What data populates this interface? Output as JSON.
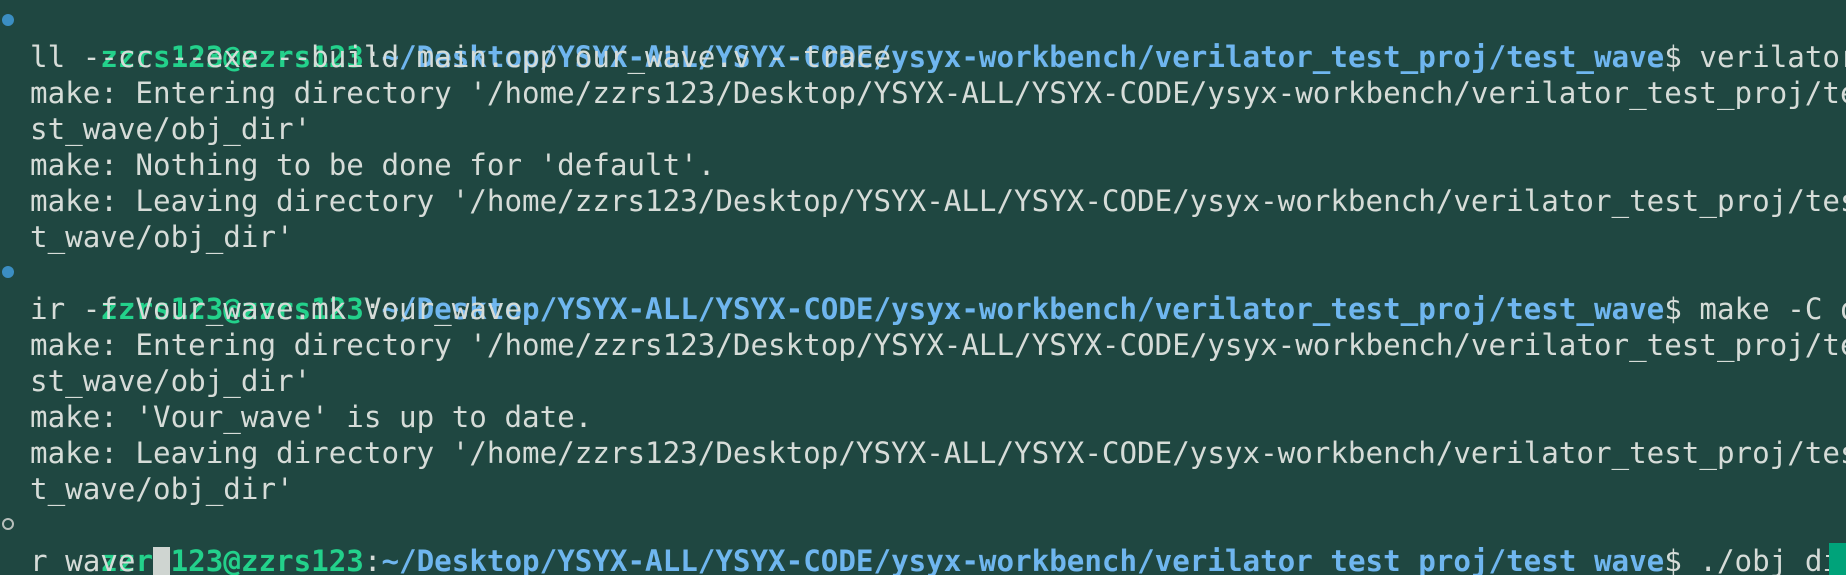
{
  "prompt": {
    "user_host": "zzrs123@zzrs123",
    "path": "~/Desktop/YSYX-ALL/YSYX-CODE/ysyx-workbench/verilator_test_proj/test_wave",
    "symbol": "$"
  },
  "blocks": [
    {
      "status": "done",
      "command_first": " verilator -Wa",
      "command_rest": [
        "ll --cc --exe --build main.cpp our_wave.v --trace"
      ],
      "output": [
        "make: Entering directory '/home/zzrs123/Desktop/YSYX-ALL/YSYX-CODE/ysyx-workbench/verilator_test_proj/te",
        "st_wave/obj_dir'",
        "make: Nothing to be done for 'default'.",
        "make: Leaving directory '/home/zzrs123/Desktop/YSYX-ALL/YSYX-CODE/ysyx-workbench/verilator_test_proj/tes",
        "t_wave/obj_dir'"
      ]
    },
    {
      "status": "done",
      "command_first": " make -C obj_d",
      "command_rest": [
        "ir -f Vour_wave.mk Vour_wave"
      ],
      "output": [
        "make: Entering directory '/home/zzrs123/Desktop/YSYX-ALL/YSYX-CODE/ysyx-workbench/verilator_test_proj/te",
        "st_wave/obj_dir'",
        "make: 'Vour_wave' is up to date.",
        "make: Leaving directory '/home/zzrs123/Desktop/YSYX-ALL/YSYX-CODE/ysyx-workbench/verilator_test_proj/tes",
        "t_wave/obj_dir'"
      ]
    },
    {
      "status": "pending",
      "command_first": " ./obj_dir/Vou",
      "command_rest": [
        "r_wave "
      ],
      "output": []
    }
  ],
  "colors": {
    "background": "#1f4741",
    "user_host": "#23d18b",
    "path": "#6fb6ef",
    "text": "#d6dcd8",
    "marker_done": "#3b8ec2"
  }
}
